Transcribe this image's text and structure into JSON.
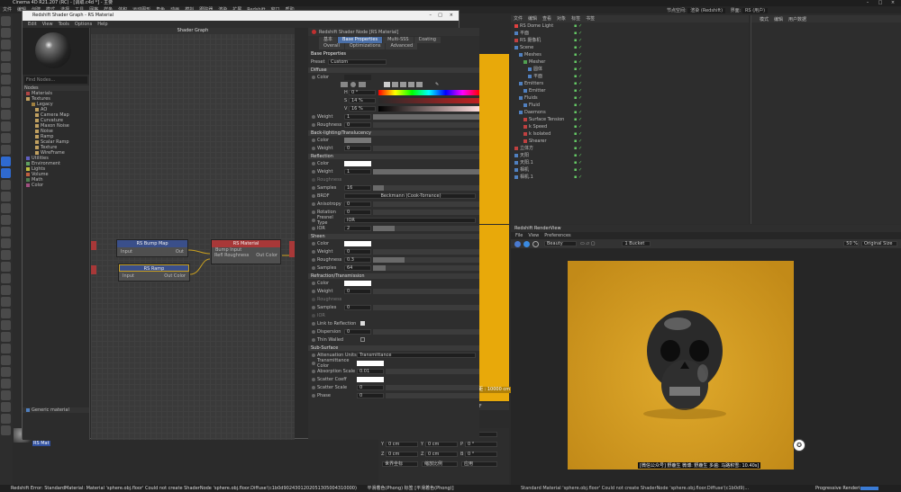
{
  "window_title": "Cinema 4D R21.207 (RC) - [调取.c4d *] - 主要",
  "menu": [
    "文件",
    "编辑",
    "创建",
    "模式",
    "选择",
    "工具",
    "网格",
    "样条",
    "体积",
    "运动图形",
    "角色",
    "动画",
    "模拟",
    "跟踪器",
    "渲染",
    "扩展",
    "Redshift",
    "窗口",
    "帮助"
  ],
  "layout": {
    "node_space_label": "节点空间:",
    "node_space_value": "渲染 (Redshift)",
    "interface_label": "界面:",
    "interface_value": "RS (用户)"
  },
  "shader_graph": {
    "title": "Redshift Shader Graph - RS Material",
    "menu": [
      "Edit",
      "View",
      "Tools",
      "Options",
      "Help"
    ],
    "graph_header": "Shader Graph",
    "find_placeholder": "Find Nodes...",
    "nodes_label": "Nodes",
    "generic_label": "Generic material",
    "tree": [
      {
        "label": "Materials",
        "color": "#b04545"
      },
      {
        "label": "Textures",
        "color": "#c0a060"
      },
      {
        "label": "Legacy",
        "color": "#a08040"
      },
      {
        "label": "AO",
        "color": "#c0a060"
      },
      {
        "label": "Camera Map",
        "color": "#c0a060"
      },
      {
        "label": "Curvature",
        "color": "#c0a060"
      },
      {
        "label": "Maxon Noise",
        "color": "#c0a060"
      },
      {
        "label": "Noise",
        "color": "#c0a060"
      },
      {
        "label": "Ramp",
        "color": "#c0a060"
      },
      {
        "label": "Scalar Ramp",
        "color": "#c0a060"
      },
      {
        "label": "Texture",
        "color": "#c0a060"
      },
      {
        "label": "WireFrame",
        "color": "#c0a060"
      },
      {
        "label": "Utilities",
        "color": "#6060c0"
      },
      {
        "label": "Environment",
        "color": "#60a060"
      },
      {
        "label": "Lights",
        "color": "#c0c040"
      },
      {
        "label": "Volume",
        "color": "#c06040"
      },
      {
        "label": "Math",
        "color": "#508050"
      },
      {
        "label": "Color",
        "color": "#a05080"
      }
    ],
    "nodes": {
      "bump": {
        "title": "RS Bump Map",
        "in": "Input",
        "out": "Out"
      },
      "ramp": {
        "title": "RS Ramp",
        "in": "Input",
        "out": "Out Color"
      },
      "mat": {
        "title": "RS Material",
        "in1": "Bump Input",
        "in2": "Refl Roughness",
        "out": "Out Color"
      }
    }
  },
  "attributes": {
    "header": "Redshift Shader Node [RS Material]",
    "tabs1": [
      "基本",
      "Base Properties",
      "Multi-SSS",
      "Coating"
    ],
    "tabs2": [
      "Overall",
      "Optimizations",
      "Advanced"
    ],
    "section_base": "Base Properties",
    "preset_label": "Preset",
    "preset_value": "Custom",
    "diffuse": {
      "title": "Diffuse",
      "color_label": "Color",
      "h_label": "H",
      "h_val": "0 °",
      "s_label": "S",
      "s_val": "14 %",
      "v_label": "V",
      "v_val": "16 %",
      "weight_label": "Weight",
      "weight_val": "1",
      "rough_label": "Roughness",
      "rough_val": "0"
    },
    "backlight": {
      "title": "Back-lighting/Translucency",
      "color_label": "Color",
      "weight_label": "Weight",
      "weight_val": "0"
    },
    "reflection": {
      "title": "Reflection",
      "color_label": "Color",
      "weight_label": "Weight",
      "weight_val": "1",
      "rough_label": "Roughness",
      "samples_label": "Samples",
      "samples_val": "16",
      "brdf_label": "BRDF",
      "brdf_val": "Beckmann (Cook-Torrance)",
      "aniso_label": "Anisotropy",
      "aniso_val": "0",
      "rot_label": "Rotation",
      "rot_val": "0",
      "fresnel_label": "Fresnel Type",
      "fresnel_val": "IOR",
      "ior_label": "IOR",
      "ior_val": "2"
    },
    "sheen": {
      "title": "Sheen",
      "color_label": "Color",
      "weight_label": "Weight",
      "weight_val": "0",
      "rough_label": "Roughness",
      "rough_val": "0.3",
      "samples_label": "Samples",
      "samples_val": "64"
    },
    "refraction": {
      "title": "Refraction/Transmission",
      "color_label": "Color",
      "weight_label": "Weight",
      "weight_val": "0",
      "rough_label": "Roughness",
      "samples_label": "Samples",
      "samples_val": "0",
      "ior_label": "IOR",
      "link_label": "Link to Reflection",
      "disp_label": "Dispersion",
      "disp_val": "0",
      "thin_label": "Thin Walled"
    },
    "subsurface": {
      "title": "Sub-Surface",
      "atten_label": "Attenuation Units",
      "atten_val": "Transmittance",
      "tc_label": "Transmittance Color",
      "as_label": "Absorption Scale",
      "as_val": "0.01",
      "sc_label": "Scatter Coeff",
      "ss_label": "Scatter Scale",
      "ss_val": "0",
      "phase_label": "Phase",
      "phase_val": "0"
    }
  },
  "object_manager": {
    "menu": [
      "文件",
      "编辑",
      "查看",
      "对象",
      "标签",
      "书签"
    ],
    "items": [
      {
        "label": "RS Dome Light",
        "indent": 0,
        "color": "#e04040"
      },
      {
        "label": "平面",
        "indent": 0,
        "color": "#5080c0"
      },
      {
        "label": "RS 摄像机",
        "indent": 0,
        "color": "#c04040"
      },
      {
        "label": "Scene",
        "indent": 0,
        "color": "#5080c0"
      },
      {
        "label": "Meshes",
        "indent": 1,
        "color": "#5080c0"
      },
      {
        "label": "Mesher",
        "indent": 2,
        "color": "#50a050"
      },
      {
        "label": "圆体",
        "indent": 3,
        "color": "#5080c0"
      },
      {
        "label": "平面",
        "indent": 3,
        "color": "#5080c0"
      },
      {
        "label": "Emitters",
        "indent": 1,
        "color": "#5080c0"
      },
      {
        "label": "Emitter",
        "indent": 2,
        "color": "#5080c0"
      },
      {
        "label": "Fluids",
        "indent": 1,
        "color": "#5080c0"
      },
      {
        "label": "Fluid",
        "indent": 2,
        "color": "#5080c0"
      },
      {
        "label": "Daemons",
        "indent": 1,
        "color": "#5080c0"
      },
      {
        "label": "Surface Tension",
        "indent": 2,
        "color": "#c04040"
      },
      {
        "label": "k Speed",
        "indent": 2,
        "color": "#c04040"
      },
      {
        "label": "k Isolated",
        "indent": 2,
        "color": "#c04040"
      },
      {
        "label": "Shearer",
        "indent": 2,
        "color": "#c04040"
      },
      {
        "label": "立体方",
        "indent": 0,
        "color": "#c04040"
      },
      {
        "label": "天阳",
        "indent": 0,
        "color": "#5080c0"
      },
      {
        "label": "天阳.1",
        "indent": 0,
        "color": "#5080c0"
      },
      {
        "label": "相机",
        "indent": 0,
        "color": "#5080c0"
      },
      {
        "label": "相机.1",
        "indent": 0,
        "color": "#5080c0"
      }
    ]
  },
  "right_panel": {
    "menu": [
      "模式",
      "编辑",
      "用户数据"
    ]
  },
  "render_view": {
    "title": "Redshift RenderView",
    "menu": [
      "File",
      "View",
      "Preferences"
    ],
    "beauty": "Beauty",
    "bucket": "1 Bucket",
    "zoom": "50 %",
    "size_label": "Original Size",
    "caption": "[微信公众号] 野鹿生  微博: 野鹿生  多遍: 马路积雪: 10.40s]"
  },
  "viewport": {
    "grid_label": "网格间距 : 10000 cm"
  },
  "coords": {
    "rows": [
      {
        "a": "X",
        "av": "0 cm",
        "b": "X",
        "bv": "0 cm",
        "c": "H",
        "cv": "0 °"
      },
      {
        "a": "Y",
        "av": "0 cm",
        "b": "Y",
        "bv": "0 cm",
        "c": "P",
        "cv": "0 °"
      },
      {
        "a": "Z",
        "av": "0 cm",
        "b": "Z",
        "bv": "0 cm",
        "c": "B",
        "cv": "0 °"
      }
    ],
    "apply": "应用",
    "world": "世界坐标",
    "scale": "缩放比例"
  },
  "timeline": {
    "frame": "0 F"
  },
  "material": {
    "label": "RS Mat"
  },
  "status": {
    "left": "Redshift Error: StandardMaterial: Material 'sphere.obj.floor' Could not create ShaderNode 'sphere.obj.floor.Diffuse'(c1b0d9024301202051305004310000)",
    "hint": "平滑着色(Phong) 标签 [平滑着色(Phong)]",
    "render_left": "Standard Material 'sphere.obj.floor' Could not create ShaderNode 'sphere.obj.floor.Diffuse'(c1b0d9)...",
    "render_right": "Progressive Rendering"
  }
}
